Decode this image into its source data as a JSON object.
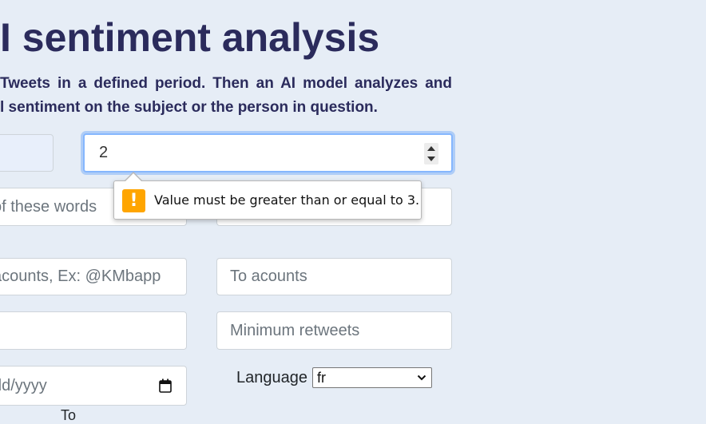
{
  "header": {
    "title": "I sentiment analysis",
    "description_line1": "Tweets in a defined period. Then an AI model analyzes and",
    "description_line2": "l sentiment on the subject or the person in question."
  },
  "form": {
    "count_value": "2",
    "any_words_placeholder": "of these words",
    "from_accounts_placeholder": "acounts, Ex: @KMbapp",
    "to_accounts_placeholder": "To acounts",
    "min_retweets_placeholder": "Minimum retweets",
    "date_placeholder": "dd/yyyy",
    "language_label": "Language",
    "language_selected": "fr",
    "to_label": "To"
  },
  "validation": {
    "message": "Value must be greater than or equal to 3.",
    "icon": "warning-icon"
  },
  "colors": {
    "page_background": "#e6edf6",
    "title_color": "#2b2b5c",
    "focus_border": "#86b7fe",
    "warning": "#ffa500"
  }
}
